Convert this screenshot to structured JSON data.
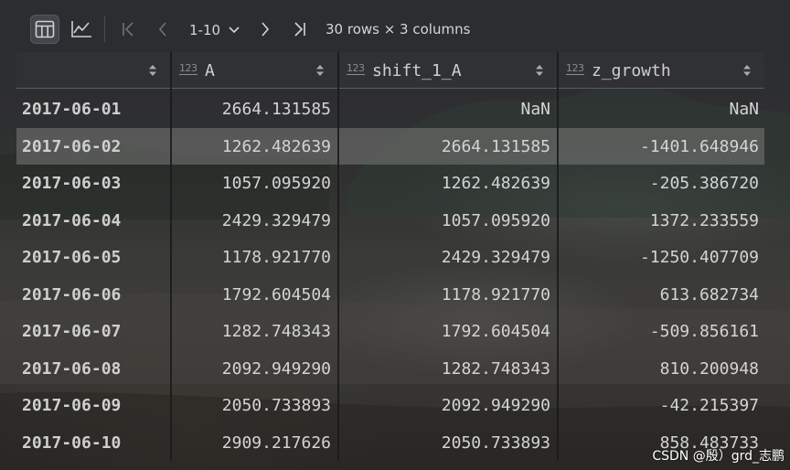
{
  "toolbar": {
    "table_view_icon": "table-icon",
    "chart_view_icon": "line-chart-icon",
    "first_page_icon": "first-page-icon",
    "prev_page_icon": "chevron-left-icon",
    "next_page_icon": "chevron-right-icon",
    "last_page_icon": "last-page-icon",
    "page_range": "1-10",
    "row_info": "30 rows × 3 columns"
  },
  "table": {
    "columns": [
      {
        "type_badge": "",
        "name": ""
      },
      {
        "type_badge": "123",
        "name": "A"
      },
      {
        "type_badge": "123",
        "name": "shift_1_A"
      },
      {
        "type_badge": "123",
        "name": "z_growth"
      }
    ],
    "selected_row_index": 1,
    "rows": [
      [
        "2017-06-01",
        "2664.131585",
        "NaN",
        "NaN"
      ],
      [
        "2017-06-02",
        "1262.482639",
        "2664.131585",
        "-1401.648946"
      ],
      [
        "2017-06-03",
        "1057.095920",
        "1262.482639",
        "-205.386720"
      ],
      [
        "2017-06-04",
        "2429.329479",
        "1057.095920",
        "1372.233559"
      ],
      [
        "2017-06-05",
        "1178.921770",
        "2429.329479",
        "-1250.407709"
      ],
      [
        "2017-06-06",
        "1792.604504",
        "1178.921770",
        "613.682734"
      ],
      [
        "2017-06-07",
        "1282.748343",
        "1792.604504",
        "-509.856161"
      ],
      [
        "2017-06-08",
        "2092.949290",
        "1282.748343",
        "810.200948"
      ],
      [
        "2017-06-09",
        "2050.733893",
        "2092.949290",
        "-42.215397"
      ],
      [
        "2017-06-10",
        "2909.217626",
        "2050.733893",
        "858.483733"
      ]
    ]
  },
  "watermark": "CSDN @殷）grd_志鹏",
  "colors": {
    "toolbar_bg": "#2b2d30",
    "header_bg": "#303135",
    "selected_row": "#6f706e",
    "text": "#d4d4d4"
  }
}
